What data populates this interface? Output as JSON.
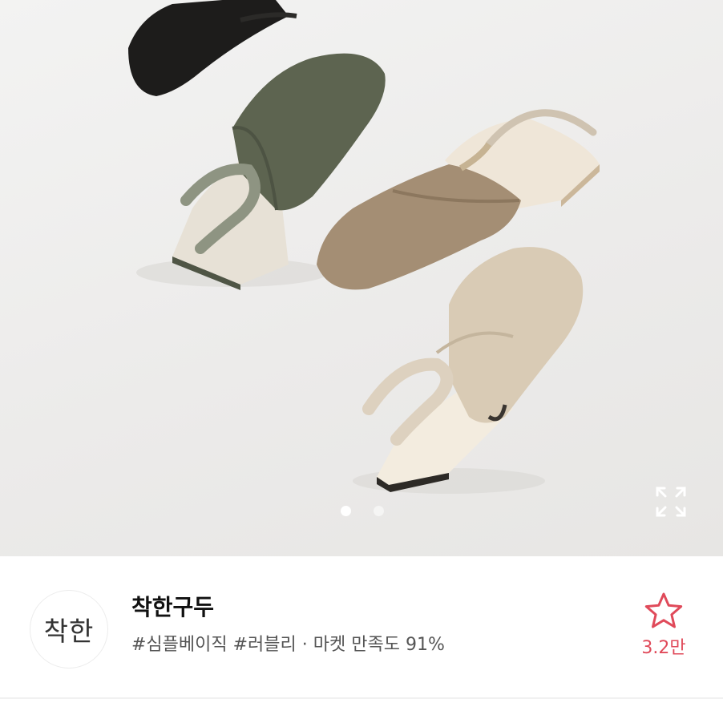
{
  "hero": {
    "image": "knit-slingback-flat-shoes-photo",
    "slide_count": 2,
    "active_slide": 1,
    "expand_icon": "expand-icon",
    "colors": {
      "black": "#1d1c1b",
      "khaki": "#5d6450",
      "camel": "#a48e74",
      "beige": "#d9cbb5"
    }
  },
  "seller": {
    "logo_text": "착한",
    "name": "착한구두",
    "tags": "#심플베이직 #러블리 · 마켓 만족도 91%",
    "favorite_icon": "star-outline-icon",
    "favorite_count": "3.2만",
    "accent_color": "#e04a5a"
  }
}
